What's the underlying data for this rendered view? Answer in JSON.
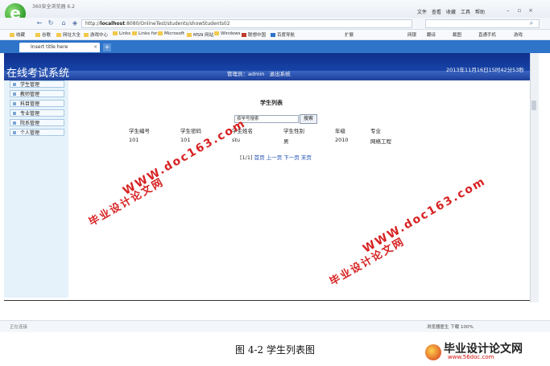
{
  "browser": {
    "app_title": "360安全浏览器 6.2",
    "menu": [
      "文件",
      "查看",
      "收藏",
      "工具",
      "帮助"
    ],
    "url_prefix": "http://",
    "url_host": "localhost",
    "url_rest": ":8080/OnlineTest/students/showStudents02",
    "bookmarks": [
      "收藏",
      "谷歌",
      "网址大全",
      "游戏中心",
      "Links",
      "Links for",
      "Microsoft",
      "MSN 网站",
      "Windows",
      "联想中国",
      "百度导航"
    ],
    "toolbar_right": [
      "扩展",
      "网银",
      "翻译",
      "截图",
      "直通手机",
      "游戏"
    ],
    "tab_title": "Insert title here",
    "status_left": "正在连接",
    "status_right": "浏览器医生   下载   100%"
  },
  "page": {
    "system_title": "在线考试系统",
    "admin_label": "管理员：admin",
    "logout_label": "退出系统",
    "datetime": "2013年11月16日15时42分53秒",
    "sidebar": [
      "学生管理",
      "教师管理",
      "科目管理",
      "专业管理",
      "院系管理",
      "个人管理"
    ],
    "list_title": "学生列表",
    "search_placeholder": "按学号搜索",
    "search_button": "搜索",
    "columns": [
      "学生编号",
      "学生密码",
      "学生姓名",
      "学生性别",
      "年级",
      "专业"
    ],
    "rows": [
      [
        "101",
        "101",
        "stu",
        "男",
        "2010",
        "网络工程"
      ]
    ],
    "pager": {
      "info": "[1/1]",
      "first": "首页",
      "prev": "上一页",
      "next": "下一页",
      "last": "末页"
    }
  },
  "figure": {
    "caption": "图 4-2 学生列表图",
    "watermark_cn": "毕业设计论文网",
    "watermark_url": "WWW.doc163.com",
    "corner_brand": "毕业设计论文网",
    "corner_url": "www.56doc.com"
  },
  "colors": {
    "header_blue": "#1b4fb5",
    "sidebar_bg": "#e6f2fa",
    "tab_strip": "#2e74c9",
    "watermark_red": "#d41010"
  }
}
